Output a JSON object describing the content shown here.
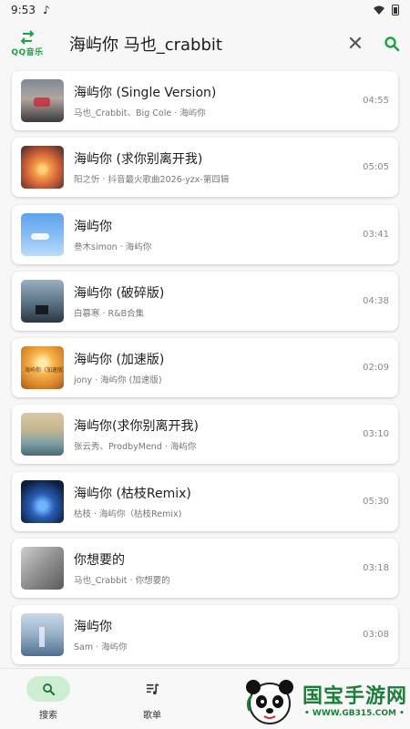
{
  "status_bar": {
    "time": "9:53",
    "music_glyph": "♪"
  },
  "header": {
    "logo_label": "QQ音乐",
    "search_query": "海屿你 马也_crabbit",
    "accent": "#21a048"
  },
  "songs": [
    {
      "title": "海屿你 (Single Version)",
      "subtitle": "马也_Crabbit、Big Cole · 海屿你",
      "duration": "04:55",
      "cover": "c1"
    },
    {
      "title": "海屿你 (求你别离开我)",
      "subtitle": "阳之忻 · 抖音最火歌曲2026-yzx-第四辑",
      "duration": "05:05",
      "cover": "c2"
    },
    {
      "title": "海屿你",
      "subtitle": "叁木simon · 海屿你",
      "duration": "03:41",
      "cover": "c3"
    },
    {
      "title": "海屿你 (破碎版)",
      "subtitle": "白慕寒 · R&B合集",
      "duration": "04:38",
      "cover": "c4"
    },
    {
      "title": "海屿你 (加速版)",
      "subtitle": "jony · 海屿你 (加速版)",
      "duration": "02:09",
      "cover": "c5",
      "cover_text": "海屿你（加速版）"
    },
    {
      "title": "海屿你(求你别离开我)",
      "subtitle": "张云秀、ProdbyMend · 海屿你",
      "duration": "03:10",
      "cover": "c6"
    },
    {
      "title": "海屿你 (枯枝Remix)",
      "subtitle": "枯枝 · 海屿你（枯枝Remix)",
      "duration": "05:30",
      "cover": "c7"
    },
    {
      "title": "你想要的",
      "subtitle": "马也_Crabbit · 你想要的",
      "duration": "03:18",
      "cover": "c8"
    },
    {
      "title": "海屿你",
      "subtitle": "Sam · 海屿你",
      "duration": "03:08",
      "cover": "c9"
    }
  ],
  "bottom_nav": {
    "search_label": "搜索",
    "playlist_label": "歌单",
    "active_color": "#cdeed2"
  },
  "watermark": {
    "brand": "国宝手游网",
    "url": "• WWW.GB315.COM •"
  }
}
